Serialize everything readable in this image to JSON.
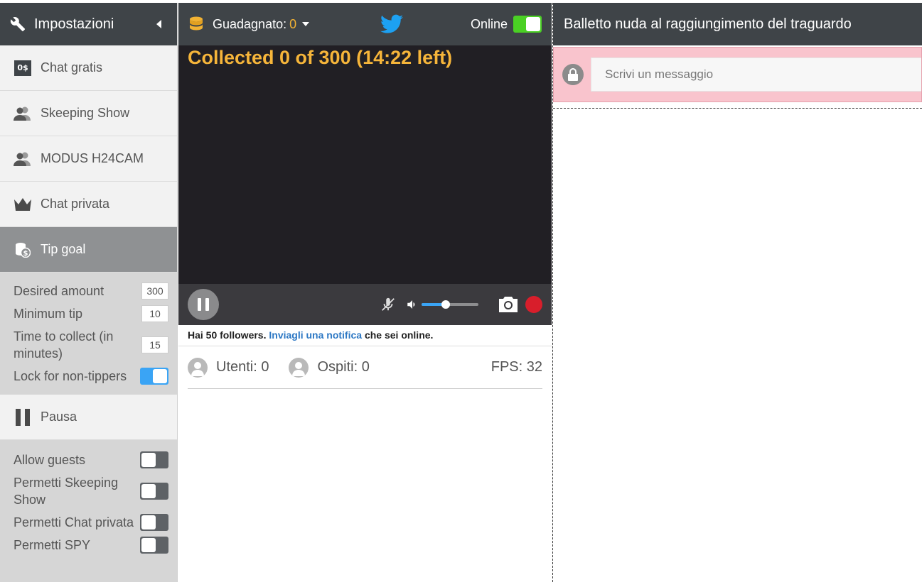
{
  "sidebar": {
    "title": "Impostazioni",
    "items": [
      {
        "label": "Chat gratis",
        "icon": "free-chat-icon",
        "badge": "0$"
      },
      {
        "label": "Skeeping Show",
        "icon": "users-icon"
      },
      {
        "label": "MODUS H24CAM",
        "icon": "users-icon"
      },
      {
        "label": "Chat privata",
        "icon": "crown-icon"
      },
      {
        "label": "Tip goal",
        "icon": "coins-dollar-icon"
      }
    ],
    "tip_goal": {
      "desired_amount_label": "Desired amount",
      "desired_amount_value": "300",
      "minimum_tip_label": "Minimum tip",
      "minimum_tip_value": "10",
      "time_to_collect_label": "Time to collect (in minutes)",
      "time_to_collect_value": "15",
      "lock_label": "Lock for non-tippers",
      "lock_on": true
    },
    "pausa_label": "Pausa",
    "permissions": [
      {
        "label": "Allow guests",
        "on": false
      },
      {
        "label": "Permetti Skeeping Show",
        "on": false
      },
      {
        "label": "Permetti Chat privata",
        "on": false
      },
      {
        "label": "Permetti SPY",
        "on": false
      }
    ]
  },
  "topbar": {
    "earned_label": "Guadagnato:",
    "earned_value": "0",
    "online_label": "Online",
    "online_on": true
  },
  "video": {
    "goal_text": "Collected 0 of 300 (14:22 left)",
    "volume_level": 0.42
  },
  "followers": {
    "prefix": "Hai 50 followers.",
    "link": "Inviagli una notifica",
    "suffix": "che sei online."
  },
  "stats": {
    "users": "Utenti: 0",
    "guests": "Ospiti: 0",
    "fps": "FPS: 32"
  },
  "chat": {
    "title": "Balletto nuda al raggiungimento del traguardo",
    "placeholder": "Scrivi un messaggio"
  },
  "colors": {
    "accent_gold": "#f6b53a",
    "toggle_blue": "#3aa4f5",
    "online_green": "#4ad024",
    "record_red": "#d81e2b",
    "chat_lock_pink": "#f9c4cd"
  }
}
